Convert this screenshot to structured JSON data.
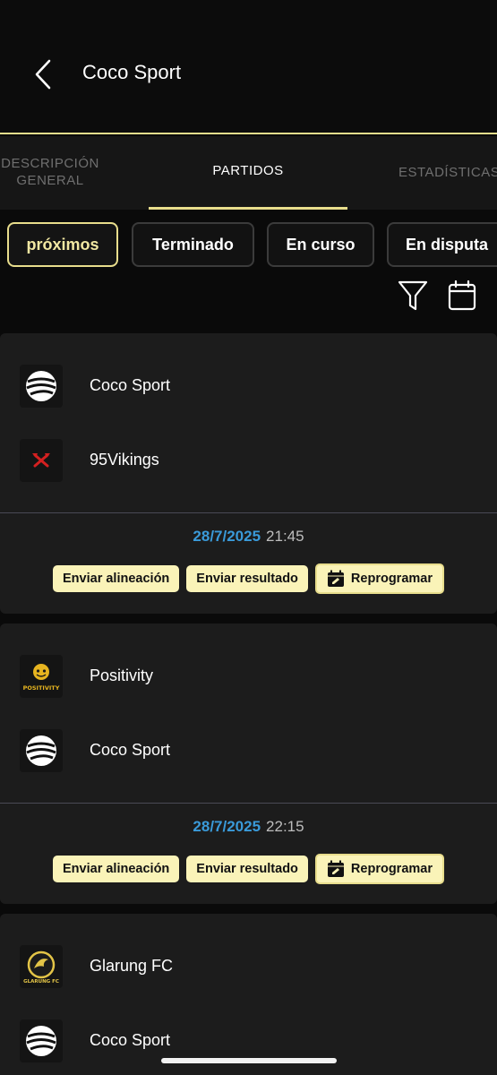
{
  "header": {
    "title": "Coco Sport"
  },
  "tabs": [
    {
      "label": "DESCRIPCIÓN GENERAL",
      "active": false
    },
    {
      "label": "PARTIDOS",
      "active": true
    },
    {
      "label": "ESTADÍSTICAS",
      "active": false
    }
  ],
  "filters": [
    {
      "label": "próximos",
      "active": true
    },
    {
      "label": "Terminado",
      "active": false
    },
    {
      "label": "En curso",
      "active": false
    },
    {
      "label": "En disputa",
      "active": false
    }
  ],
  "toolbar": {
    "filter_icon": "filter-icon",
    "calendar_icon": "calendar-icon"
  },
  "matches": [
    {
      "home": {
        "name": "Coco Sport",
        "logo": "coco-sport-logo"
      },
      "away": {
        "name": "95Vikings",
        "logo": "vikings-logo"
      },
      "date": "28/7/2025",
      "time": "21:45",
      "actions": {
        "lineup": "Enviar alineación",
        "result": "Enviar resultado",
        "reschedule": "Reprogramar"
      }
    },
    {
      "home": {
        "name": "Positivity",
        "logo": "positivity-logo",
        "logo_text": "POSITIVITY"
      },
      "away": {
        "name": "Coco Sport",
        "logo": "coco-sport-logo"
      },
      "date": "28/7/2025",
      "time": "22:15",
      "actions": {
        "lineup": "Enviar alineación",
        "result": "Enviar resultado",
        "reschedule": "Reprogramar"
      }
    },
    {
      "home": {
        "name": "Glarung FC",
        "logo": "glarung-fc-logo",
        "logo_text": "GLARUNG FC"
      },
      "away": {
        "name": "Coco Sport",
        "logo": "coco-sport-logo"
      }
    }
  ],
  "colors": {
    "accent": "#e8dd8c",
    "button_bg": "#faf3b8",
    "date": "#3a9ad9",
    "card": "#1c1c1c"
  }
}
